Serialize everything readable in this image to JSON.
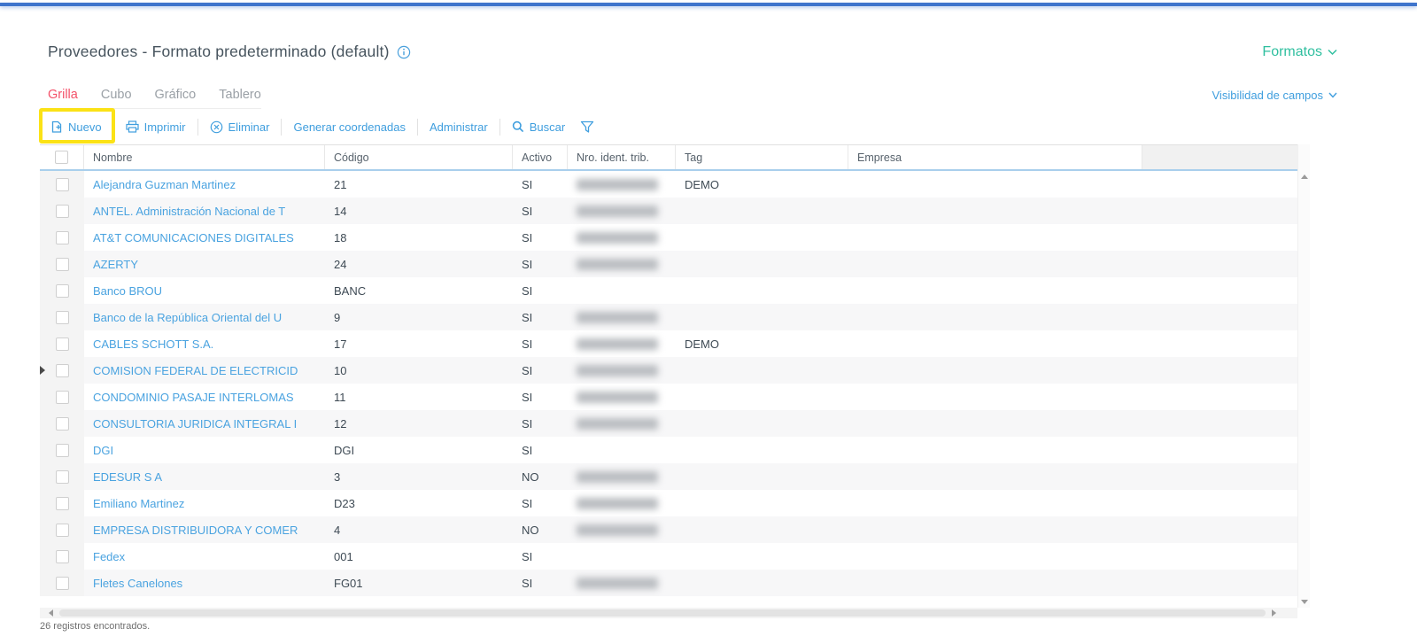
{
  "page": {
    "title": "Proveedores - Formato predeterminado (default)",
    "formats_menu": "Formatos",
    "field_visibility_menu": "Visibilidad de campos"
  },
  "tabs": [
    {
      "label": "Grilla",
      "active": true
    },
    {
      "label": "Cubo",
      "active": false
    },
    {
      "label": "Gráfico",
      "active": false
    },
    {
      "label": "Tablero",
      "active": false
    }
  ],
  "toolbar": {
    "nuevo": "Nuevo",
    "imprimir": "Imprimir",
    "eliminar": "Eliminar",
    "generar_coordenadas": "Generar coordenadas",
    "administrar": "Administrar",
    "buscar": "Buscar"
  },
  "table": {
    "columns": [
      "Nombre",
      "Código",
      "Activo",
      "Nro. ident. trib.",
      "Tag",
      "Empresa"
    ],
    "rows": [
      {
        "name": "Alejandra Guzman Martinez",
        "code": "21",
        "active": "SI",
        "nit_redacted": true,
        "tag": "DEMO",
        "company": ""
      },
      {
        "name": "ANTEL. Administración Nacional de T",
        "code": "14",
        "active": "SI",
        "nit_redacted": true,
        "tag": "",
        "company": ""
      },
      {
        "name": "AT&T COMUNICACIONES DIGITALES",
        "code": "18",
        "active": "SI",
        "nit_redacted": true,
        "tag": "",
        "company": ""
      },
      {
        "name": "AZERTY",
        "code": "24",
        "active": "SI",
        "nit_redacted": true,
        "tag": "",
        "company": ""
      },
      {
        "name": "Banco BROU",
        "code": "BANC",
        "active": "SI",
        "nit_redacted": false,
        "tag": "",
        "company": ""
      },
      {
        "name": "Banco de la República Oriental del U",
        "code": "9",
        "active": "SI",
        "nit_redacted": true,
        "tag": "",
        "company": ""
      },
      {
        "name": "CABLES SCHOTT S.A.",
        "code": "17",
        "active": "SI",
        "nit_redacted": true,
        "tag": "DEMO",
        "company": ""
      },
      {
        "name": "COMISION FEDERAL DE ELECTRICID",
        "code": "10",
        "active": "SI",
        "nit_redacted": true,
        "tag": "",
        "company": ""
      },
      {
        "name": "CONDOMINIO PASAJE INTERLOMAS",
        "code": "11",
        "active": "SI",
        "nit_redacted": true,
        "tag": "",
        "company": ""
      },
      {
        "name": "CONSULTORIA JURIDICA INTEGRAL I",
        "code": "12",
        "active": "SI",
        "nit_redacted": true,
        "tag": "",
        "company": ""
      },
      {
        "name": "DGI",
        "code": "DGI",
        "active": "SI",
        "nit_redacted": false,
        "tag": "",
        "company": ""
      },
      {
        "name": "EDESUR S A",
        "code": "3",
        "active": "NO",
        "nit_redacted": true,
        "tag": "",
        "company": ""
      },
      {
        "name": "Emiliano Martinez",
        "code": "D23",
        "active": "SI",
        "nit_redacted": true,
        "tag": "",
        "company": ""
      },
      {
        "name": "EMPRESA DISTRIBUIDORA Y COMER",
        "code": "4",
        "active": "NO",
        "nit_redacted": true,
        "tag": "",
        "company": ""
      },
      {
        "name": "Fedex",
        "code": "001",
        "active": "SI",
        "nit_redacted": false,
        "tag": "",
        "company": ""
      },
      {
        "name": "Fletes Canelones",
        "code": "FG01",
        "active": "SI",
        "nit_redacted": true,
        "tag": "",
        "company": ""
      }
    ]
  },
  "footer": {
    "status": "26 registros encontrados."
  },
  "colors": {
    "topbar_blue": "#3e74cc",
    "accent_blue": "#3f9ede",
    "link_blue": "#4aa3e0",
    "tab_active_red": "#f4526a",
    "formats_green": "#2fbf9f",
    "header_border_blue": "#a9cfec",
    "highlight_yellow": "#fbe216"
  }
}
